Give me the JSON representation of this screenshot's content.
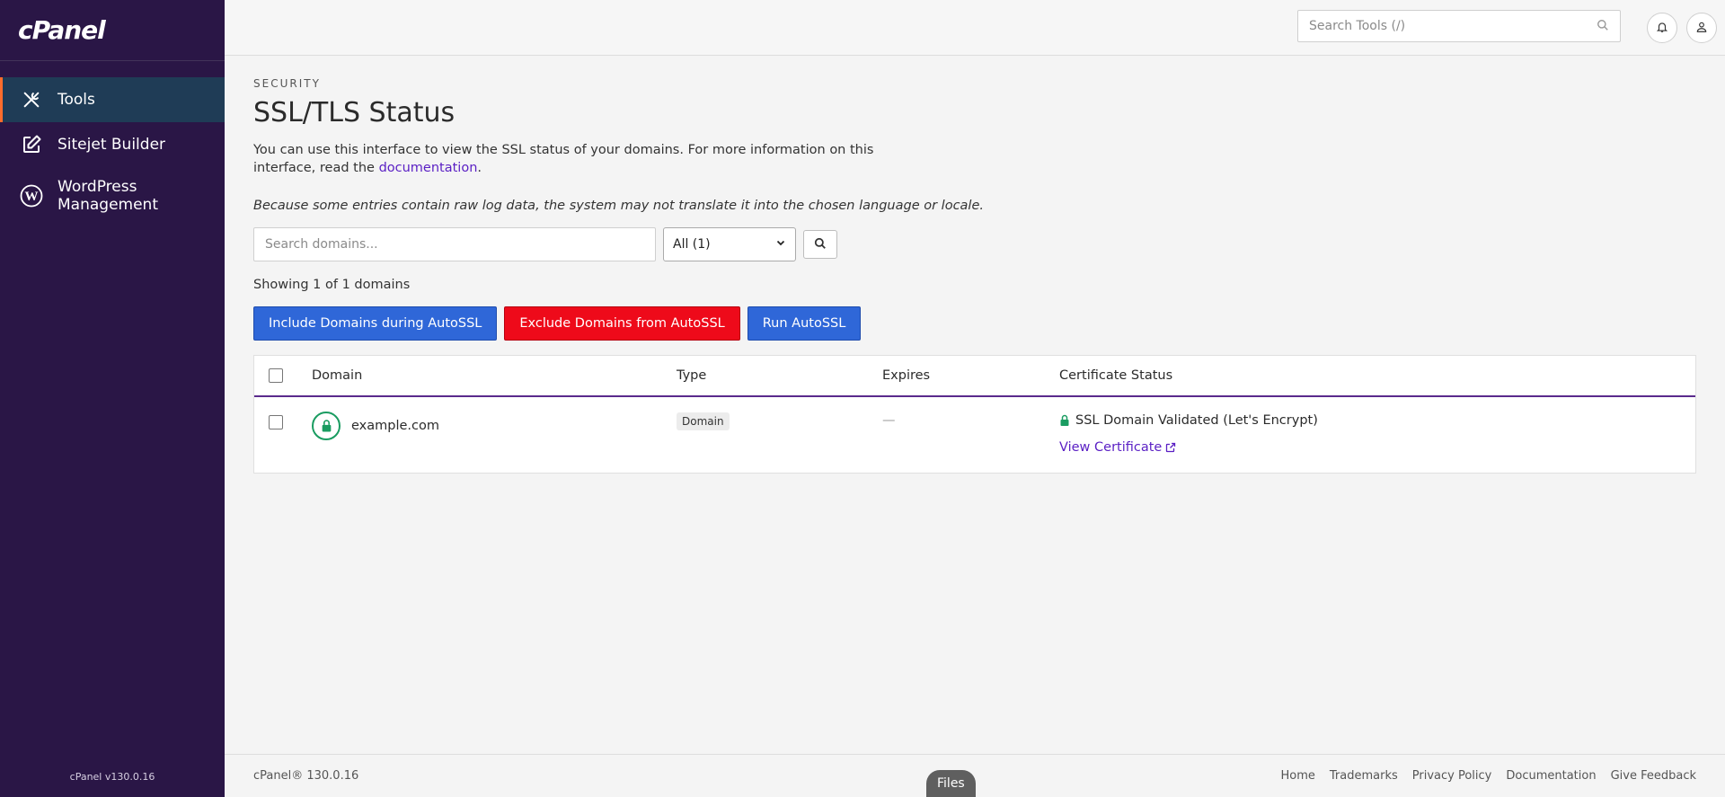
{
  "sidebar": {
    "logo": "cPanel",
    "items": [
      {
        "label": "Tools",
        "icon": "tools-icon"
      },
      {
        "label": "Sitejet Builder",
        "icon": "edit-icon"
      },
      {
        "label": "WordPress\nManagement",
        "icon": "wordpress-icon"
      }
    ],
    "version": "cPanel v130.0.16"
  },
  "topbar": {
    "search_placeholder": "Search Tools (/)"
  },
  "main": {
    "section_label": "SECURITY",
    "title": "SSL/TLS Status",
    "description": "You can use this interface to view the SSL status of your domains. For more information on this interface, read the",
    "doc_link": "documentation",
    "doc_suffix": ".",
    "note": "Because some entries contain raw log data, the system may not translate it into the chosen language or locale.",
    "domain_search_placeholder": "Search domains...",
    "filter_value": "All (1)",
    "showing": "Showing 1 of 1 domains",
    "buttons": {
      "include": "Include Domains during AutoSSL",
      "exclude": "Exclude Domains from AutoSSL",
      "run": "Run AutoSSL"
    },
    "table": {
      "headers": {
        "domain": "Domain",
        "type": "Type",
        "expires": "Expires",
        "status": "Certificate Status"
      },
      "rows": [
        {
          "domain": "example.com",
          "type": "Domain",
          "expires": "—",
          "status": "SSL Domain Validated (Let's Encrypt)",
          "view_cert": "View Certificate"
        }
      ]
    }
  },
  "footer": {
    "version": "cPanel® 130.0.16",
    "links": [
      "Home",
      "Trademarks",
      "Privacy Policy",
      "Documentation",
      "Give Feedback"
    ],
    "files_pill": "Files"
  },
  "colors": {
    "sidebar_bg": "#2a1646",
    "active_item_bg": "#1f3c56",
    "active_accent": "#ff6c2c",
    "primary_blue": "#2f67d8",
    "danger_red": "#ee0a1a",
    "success_green": "#1a9c61",
    "link_purple": "#5a1fc4",
    "table_header_border": "#5a2a8c"
  }
}
